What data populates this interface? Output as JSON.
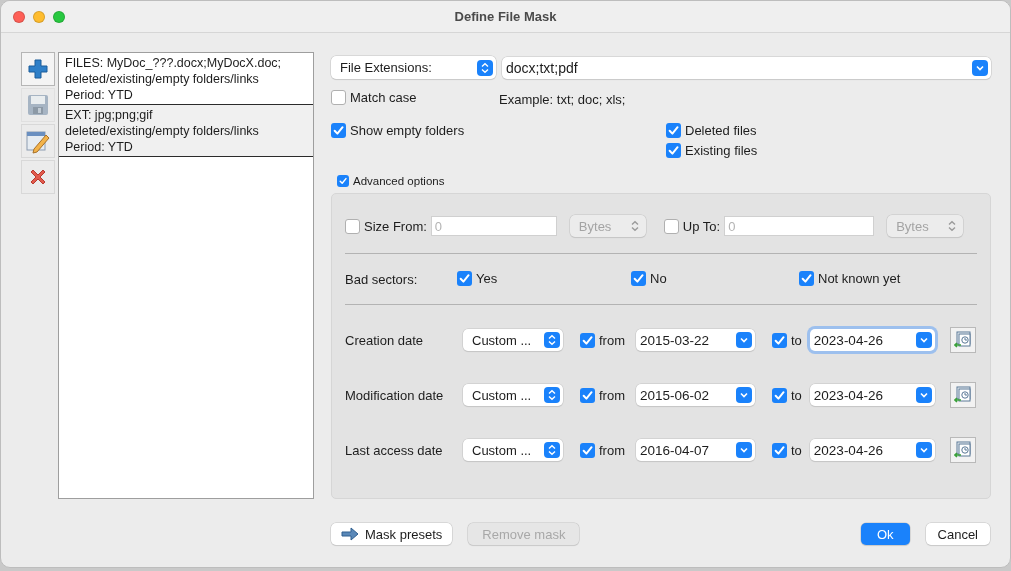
{
  "window": {
    "title": "Define File Mask"
  },
  "toolbar": [
    {
      "kind": "add",
      "disabled": false
    },
    {
      "kind": "save",
      "disabled": true
    },
    {
      "kind": "edit",
      "disabled": false
    },
    {
      "kind": "delete",
      "disabled": false
    }
  ],
  "masks": [
    {
      "lines": [
        "FILES: MyDoc_???.docx;MyDocX.doc;",
        "deleted/existing/empty folders/links",
        "Period: YTD"
      ],
      "selected": false
    },
    {
      "lines": [
        "EXT: jpg;png;gif",
        "deleted/existing/empty folders/links",
        "Period: YTD"
      ],
      "selected": true
    }
  ],
  "filter": {
    "type": "File Extensions:",
    "value": "docx;txt;pdf"
  },
  "match_case": {
    "label": "Match case",
    "checked": false
  },
  "example": "Example: txt; doc; xls;",
  "show_empty_folders": {
    "label": "Show empty folders",
    "checked": true
  },
  "file_states": [
    {
      "label": "Deleted files",
      "checked": true
    },
    {
      "label": "Existing files",
      "checked": true
    }
  ],
  "advanced": {
    "label": "Advanced options",
    "checked": true,
    "size_from": {
      "label": "Size From:",
      "checked": false,
      "placeholder": "0",
      "unit": "Bytes"
    },
    "size_to": {
      "label": "Up To:",
      "checked": false,
      "placeholder": "0",
      "unit": "Bytes"
    },
    "bad_sectors": {
      "label": "Bad sectors:",
      "options": [
        {
          "label": "Yes",
          "checked": true
        },
        {
          "label": "No",
          "checked": true
        },
        {
          "label": "Not known yet",
          "checked": true
        }
      ]
    },
    "dates": [
      {
        "label": "Creation date",
        "preset": "Custom ...",
        "from": {
          "label": "from",
          "checked": true,
          "value": "2015-03-22",
          "focused": false
        },
        "to": {
          "label": "to",
          "checked": true,
          "value": "2023-04-26",
          "focused": true
        }
      },
      {
        "label": "Modification date",
        "preset": "Custom ...",
        "from": {
          "label": "from",
          "checked": true,
          "value": "2015-06-02",
          "focused": false
        },
        "to": {
          "label": "to",
          "checked": true,
          "value": "2023-04-26",
          "focused": false
        }
      },
      {
        "label": "Last access date",
        "preset": "Custom ...",
        "from": {
          "label": "from",
          "checked": true,
          "value": "2016-04-07",
          "focused": false
        },
        "to": {
          "label": "to",
          "checked": true,
          "value": "2023-04-26",
          "focused": false
        }
      }
    ]
  },
  "mask_buttons": [
    {
      "label": "Mask presets",
      "kind": "presets",
      "disabled": false
    },
    {
      "label": "Remove mask",
      "kind": "plain",
      "disabled": true
    }
  ],
  "dialog_buttons": [
    {
      "label": "Ok",
      "default": true
    },
    {
      "label": "Cancel",
      "default": false
    }
  ]
}
